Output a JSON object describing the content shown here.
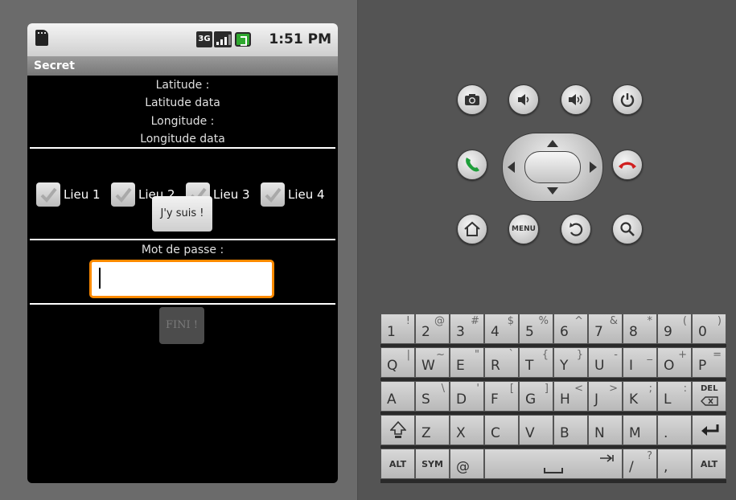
{
  "status_bar": {
    "network": "3G",
    "time": "1:51 PM"
  },
  "app": {
    "title": "Secret"
  },
  "location": {
    "latitude_label": "Latitude :",
    "latitude_value": "Latitude data",
    "longitude_label": "Longitude :",
    "longitude_value": "Longitude data"
  },
  "places": [
    {
      "label": "Lieu 1",
      "checked": false
    },
    {
      "label": "Lieu 2",
      "checked": false
    },
    {
      "label": "Lieu 3",
      "checked": false
    },
    {
      "label": "Lieu 4",
      "checked": false
    }
  ],
  "buttons": {
    "here": "J'y suis !",
    "finish": "FINI !"
  },
  "password": {
    "label": "Mot de passe :",
    "value": ""
  },
  "hardware_buttons": [
    "camera",
    "volume-down",
    "volume-up",
    "power",
    "call",
    "end-call",
    "home",
    "menu",
    "back",
    "search"
  ],
  "hw": {
    "menu_label": "MENU"
  },
  "keyboard": {
    "row1": [
      [
        "1",
        "!"
      ],
      [
        "2",
        "@"
      ],
      [
        "3",
        "#"
      ],
      [
        "4",
        "$"
      ],
      [
        "5",
        "%"
      ],
      [
        "6",
        "^"
      ],
      [
        "7",
        "&"
      ],
      [
        "8",
        "*"
      ],
      [
        "9",
        "("
      ],
      [
        "0",
        ")"
      ]
    ],
    "row2": [
      [
        "Q",
        "|"
      ],
      [
        "W",
        "~"
      ],
      [
        "E",
        "\""
      ],
      [
        "R",
        "`"
      ],
      [
        "T",
        "{"
      ],
      [
        "Y",
        "}"
      ],
      [
        "U",
        "-"
      ],
      [
        "I",
        "_"
      ],
      [
        "O",
        "+"
      ],
      [
        "P",
        "="
      ]
    ],
    "row3": [
      [
        "A",
        ""
      ],
      [
        "S",
        "\\"
      ],
      [
        "D",
        "'"
      ],
      [
        "F",
        "["
      ],
      [
        "G",
        "]"
      ],
      [
        "H",
        "<"
      ],
      [
        "J",
        ">"
      ],
      [
        "K",
        ";"
      ],
      [
        "L",
        ":"
      ]
    ],
    "row3_del": "DEL",
    "row4": [
      [
        "Z",
        ""
      ],
      [
        "X",
        ""
      ],
      [
        "C",
        ""
      ],
      [
        "V",
        ""
      ],
      [
        "B",
        ""
      ],
      [
        "N",
        ""
      ],
      [
        "M",
        ""
      ],
      [
        ".",
        ""
      ]
    ],
    "row5": {
      "alt": "ALT",
      "sym": "SYM",
      "at": "@",
      "slash": "/",
      "slash_alt": "?",
      "comma": ",",
      "alt_right": "ALT"
    }
  },
  "colors": {
    "focus": "#ff8a00",
    "call": "#1e9e3a",
    "end_call": "#d01f1f"
  }
}
